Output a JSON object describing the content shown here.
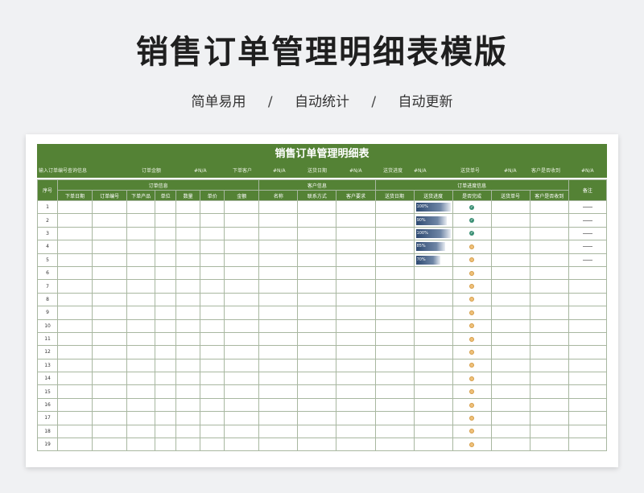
{
  "page": {
    "title": "销售订单管理明细表模版",
    "tags": [
      "简单易用",
      "自动统计",
      "自动更新"
    ],
    "separator": "/"
  },
  "sheet": {
    "title": "销售订单管理明细表",
    "query": {
      "hint": "输入订单编号查询信息",
      "fields": [
        {
          "label": "订单金额",
          "value": "#N/A"
        },
        {
          "label": "下单客户",
          "value": "#N/A"
        },
        {
          "label": "送货日期",
          "value": "#N/A"
        },
        {
          "label": "送货进度",
          "value": "#N/A"
        },
        {
          "label": "送货单号",
          "value": "#N/A"
        },
        {
          "label": "客户是否收到",
          "value": "#N/A"
        }
      ]
    },
    "header": {
      "seq": "序号",
      "group_order": "订单信息",
      "group_customer": "客户信息",
      "group_progress": "订单进度信息",
      "note": "备注",
      "cols": [
        "下单日期",
        "订单编号",
        "下单产品",
        "单位",
        "数量",
        "单价",
        "金额",
        "名称",
        "联系方式",
        "客户要求",
        "送货日期",
        "送货进度",
        "是否完成",
        "送货单号",
        "客户是否收到"
      ]
    },
    "rows": [
      {
        "n": "1",
        "progress": 1.0,
        "progress_label": "100%",
        "done": true,
        "note": true
      },
      {
        "n": "2",
        "progress": 0.9,
        "progress_label": "90%",
        "done": true,
        "note": true
      },
      {
        "n": "3",
        "progress": 1.0,
        "progress_label": "100%",
        "done": true,
        "note": true
      },
      {
        "n": "4",
        "progress": 0.85,
        "progress_label": "85%",
        "done": false,
        "note": true
      },
      {
        "n": "5",
        "progress": 0.7,
        "progress_label": "70%",
        "done": false,
        "note": true
      },
      {
        "n": "6",
        "done": false
      },
      {
        "n": "7",
        "done": false
      },
      {
        "n": "8",
        "done": false
      },
      {
        "n": "9",
        "done": false
      },
      {
        "n": "10",
        "done": false
      },
      {
        "n": "11",
        "done": false
      },
      {
        "n": "12",
        "done": false
      },
      {
        "n": "13",
        "done": false
      },
      {
        "n": "14",
        "done": false
      },
      {
        "n": "15",
        "done": false
      },
      {
        "n": "16",
        "done": false
      },
      {
        "n": "17",
        "done": false
      },
      {
        "n": "18",
        "done": false
      },
      {
        "n": "19",
        "done": false
      }
    ],
    "colors": {
      "header_green": "#548235",
      "bar_blue": "#2e4a72",
      "done_green": "#3a8f74",
      "pending_orange": "#efc07a"
    }
  }
}
